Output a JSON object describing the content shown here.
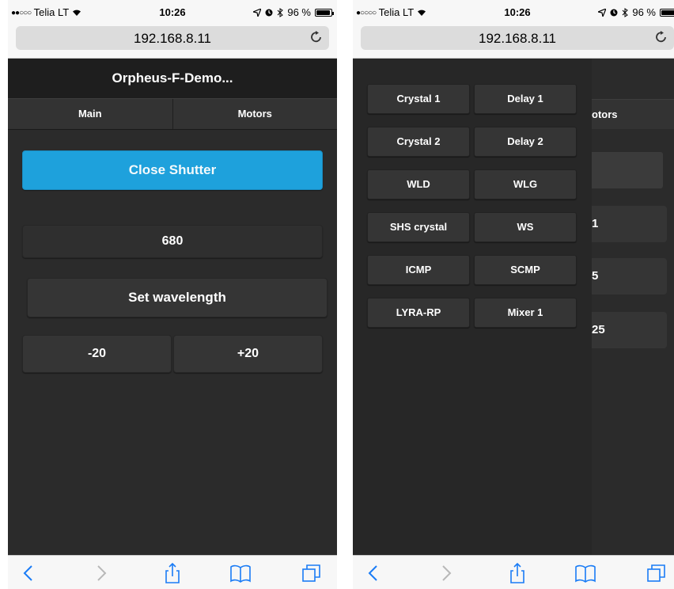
{
  "status": {
    "carrier": "Telia LT",
    "time": "10:26",
    "battery": "96 %",
    "battery_level": 0.96
  },
  "browser": {
    "url": "192.168.8.11"
  },
  "app": {
    "title": "Orpheus-F-Demo...",
    "tabs": [
      "Main",
      "Motors"
    ],
    "close_shutter_label": "Close Shutter",
    "wavelength_value": "680",
    "set_wavelength_label": "Set wavelength",
    "step_down_label": "-20",
    "step_up_label": "+20"
  },
  "menu": {
    "items": [
      [
        "Crystal 1",
        "Delay 1"
      ],
      [
        "Crystal 2",
        "Delay 2"
      ],
      [
        "WLD",
        "WLG"
      ],
      [
        "SHS crystal",
        "WS"
      ],
      [
        "ICMP",
        "SCMP"
      ],
      [
        "LYRA-RP",
        "Mixer 1"
      ]
    ]
  },
  "background_peek": {
    "tab_fragment": "otors",
    "values": [
      "1",
      "5",
      "25"
    ]
  },
  "colors": {
    "accent": "#1ea1dc",
    "ios_blue": "#1a7cf6",
    "dark_bg": "#2b2b2b"
  },
  "icons": [
    "back-icon",
    "forward-icon",
    "share-icon",
    "bookmarks-icon",
    "tabs-icon",
    "reload-icon",
    "location-icon",
    "alarm-icon",
    "bluetooth-icon",
    "wifi-icon"
  ]
}
